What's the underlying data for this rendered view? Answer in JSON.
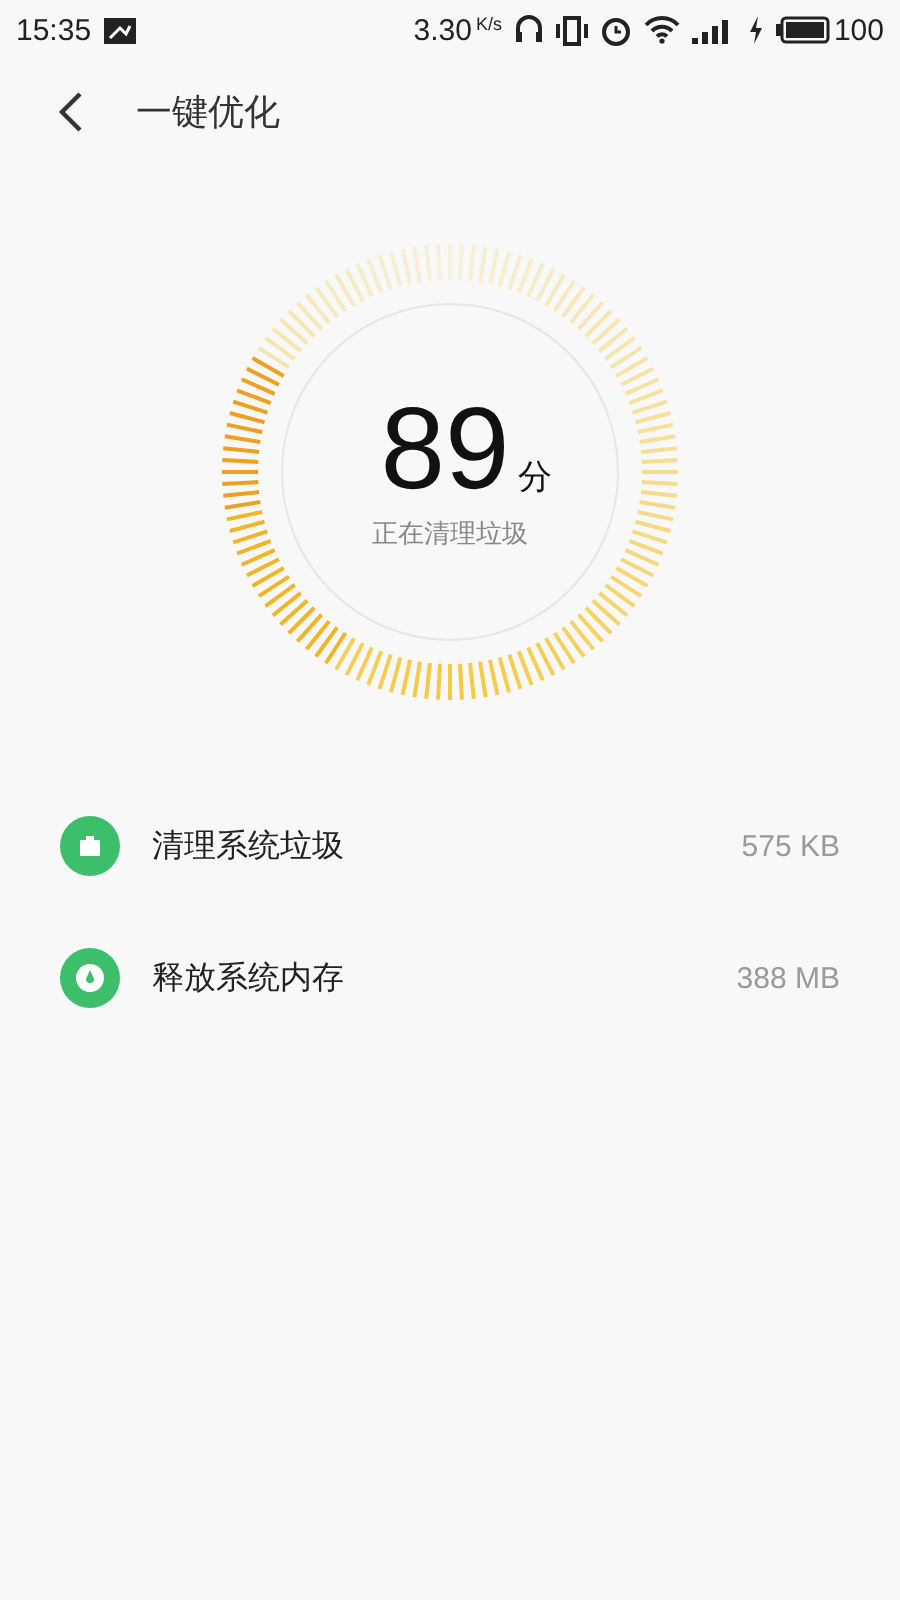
{
  "status_bar": {
    "time": "15:35",
    "speed": "3.30",
    "speed_unit": "K/s",
    "battery": "100"
  },
  "header": {
    "title": "一键优化"
  },
  "score": {
    "value": "89",
    "unit": "分",
    "status": "正在清理垃圾"
  },
  "items": [
    {
      "kind": "trash",
      "label": "清理系统垃圾",
      "value": "575 KB"
    },
    {
      "kind": "memory",
      "label": "释放系统内存",
      "value": "388 MB"
    }
  ]
}
